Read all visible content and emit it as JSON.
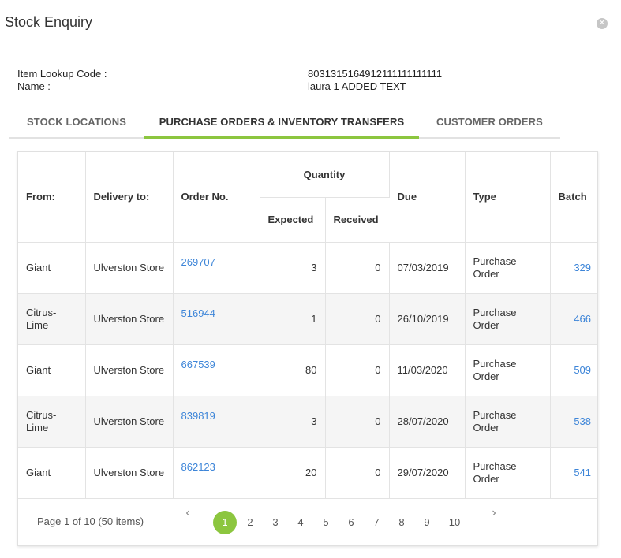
{
  "window": {
    "title": "Stock Enquiry",
    "close_icon": "close-icon"
  },
  "item": {
    "lookup_label": "Item Lookup Code :",
    "lookup_value": "8031315164912111111111111",
    "name_label": "Name :",
    "name_value": "laura 1 ADDED TEXT"
  },
  "tabs": [
    {
      "label": "STOCK LOCATIONS",
      "active": false
    },
    {
      "label": "PURCHASE ORDERS & INVENTORY TRANSFERS",
      "active": true
    },
    {
      "label": "CUSTOMER ORDERS",
      "active": false
    }
  ],
  "accent_color": "#8cc63f",
  "link_color": "#3d85d8",
  "table": {
    "headers": {
      "from": "From:",
      "delivery_to": "Delivery to:",
      "order_no": "Order No.",
      "quantity": "Quantity",
      "expected": "Expected",
      "received": "Received",
      "due": "Due",
      "type": "Type",
      "batch": "Batch"
    },
    "rows": [
      {
        "from": "Giant",
        "delivery_to": "Ulverston Store",
        "order_no": "269707",
        "expected": "3",
        "received": "0",
        "due": "07/03/2019",
        "type": "Purchase Order",
        "batch": "329"
      },
      {
        "from": "Citrus-Lime",
        "delivery_to": "Ulverston Store",
        "order_no": "516944",
        "expected": "1",
        "received": "0",
        "due": "26/10/2019",
        "type": "Purchase Order",
        "batch": "466"
      },
      {
        "from": "Giant",
        "delivery_to": "Ulverston Store",
        "order_no": "667539",
        "expected": "80",
        "received": "0",
        "due": "11/03/2020",
        "type": "Purchase Order",
        "batch": "509"
      },
      {
        "from": "Citrus-Lime",
        "delivery_to": "Ulverston Store",
        "order_no": "839819",
        "expected": "3",
        "received": "0",
        "due": "28/07/2020",
        "type": "Purchase Order",
        "batch": "538"
      },
      {
        "from": "Giant",
        "delivery_to": "Ulverston Store",
        "order_no": "862123",
        "expected": "20",
        "received": "0",
        "due": "29/07/2020",
        "type": "Purchase Order",
        "batch": "541"
      }
    ]
  },
  "pagination": {
    "summary": "Page 1 of 10 (50 items)",
    "current": "1",
    "pages": [
      "1",
      "2",
      "3",
      "4",
      "5",
      "6",
      "7",
      "8",
      "9",
      "10"
    ],
    "prev_icon": "chevron-left-icon",
    "next_icon": "chevron-right-icon"
  }
}
